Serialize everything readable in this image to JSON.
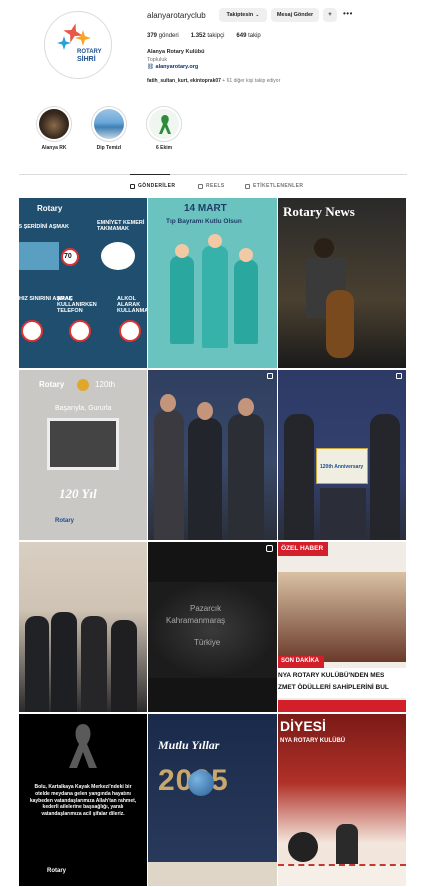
{
  "profile": {
    "username": "alanyarotaryclub",
    "logo_text_1": "ROTARY",
    "logo_text_2": "SİHRİ",
    "follow_button": "Takiptesin",
    "message_button": "Mesaj Gönder",
    "more_button": "•••",
    "posts_count": "379",
    "posts_label": "gönderi",
    "followers_count": "1.352",
    "followers_label": "takipçi",
    "following_count": "649",
    "following_label": "takip",
    "full_name": "Alanya Rotary Kulübü",
    "category": "Topluluk",
    "website": "alanyarotary.org",
    "followed_by_names": "fatih_sultan_kurt, ekintoprak07",
    "followed_by_more": " + 61 diğer kişi takip ediyor"
  },
  "highlights": [
    {
      "label": "Alanya RK"
    },
    {
      "label": "Dip Temizl"
    },
    {
      "label": "6 Ekim"
    }
  ],
  "tabs": [
    {
      "label": "GÖNDERİLER",
      "active": true
    },
    {
      "label": "REELS",
      "active": false
    },
    {
      "label": "ETİKETLENENLER",
      "active": false
    }
  ],
  "posts": [
    {
      "caption_1": "Rotary",
      "caption_2": "5 ŞERİDİNİ AŞMAK",
      "caption_3": "EMNİYET KEMERİ TAKMAMAK",
      "caption_4": "HIZ SINIRINI AŞMAK",
      "caption_5": "ARAÇ KULLANIRKEN TELEFON",
      "caption_6": "ALKOL ALARAK KULLANMAK",
      "speed": "70"
    },
    {
      "caption_1": "14 MART",
      "caption_2": "Tıp Bayramı Kutlu Olsun"
    },
    {
      "caption_1": "Rotary News"
    },
    {
      "caption_1": "Rotary",
      "caption_2": "120th",
      "caption_3": "Başarıyla, Gururla",
      "caption_4": "120 Yıl"
    },
    {},
    {
      "caption_1": "120th Anniversary"
    },
    {},
    {
      "caption_1": "Pazarcık",
      "caption_2": "Kahramanmaraş",
      "caption_3": "Türkiye"
    },
    {
      "caption_1": "ÖZEL HABER",
      "caption_2": "SON DAKİKA",
      "caption_3": "NYA ROTARY KULÜBÜ'NDEN MES",
      "caption_4": "ZMET ÖDÜLLERİ SAHİPLERİNİ BUL"
    },
    {
      "caption_1": "Bolu, Kartalkaya Kayak Merkezi'ndeki bir otelde meydana gelen yangında hayatını kaybeden vatandaşlarımıza Allah'tan rahmet, kederli ailelerine başsağlığı, yaralı vatandaşlarımıza acil şifalar dileriz.",
      "caption_2": "Rotary"
    },
    {
      "caption_1": "Mutlu Yıllar",
      "caption_2": "2025"
    },
    {
      "caption_1": "DİYESİ",
      "caption_2": "NYA ROTARY KULÜBÜ"
    }
  ],
  "colors": {
    "post_blue": "#1f4e6e",
    "post_teal": "#5fb8b5",
    "accent": "#0095f6"
  }
}
